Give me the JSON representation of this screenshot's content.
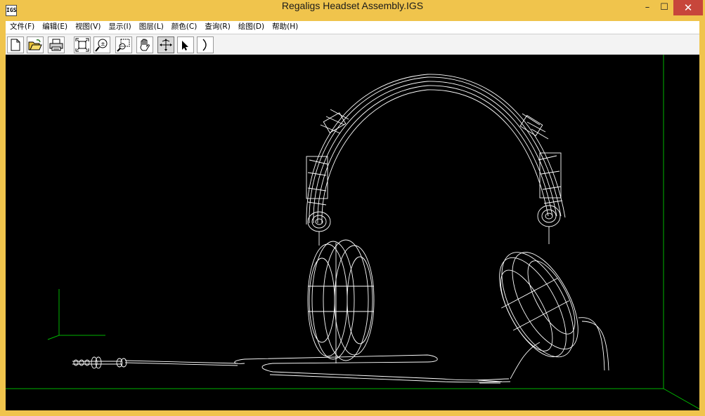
{
  "window": {
    "title": "Regaligs Headset Assembly.IGS",
    "app_icon_text": "IGS",
    "minimize_glyph": "–",
    "maximize_glyph": "☐",
    "close_glyph": "✕"
  },
  "menu": [
    {
      "label": "文件(F)"
    },
    {
      "label": "编辑(E)"
    },
    {
      "label": "视图(V)"
    },
    {
      "label": "显示(I)"
    },
    {
      "label": "图层(L)"
    },
    {
      "label": "颜色(C)"
    },
    {
      "label": "查询(R)"
    },
    {
      "label": "绘图(D)"
    },
    {
      "label": "帮助(H)"
    }
  ],
  "toolbar": {
    "buttons": [
      {
        "name": "new-file",
        "icon": "new-file-icon"
      },
      {
        "name": "open-file",
        "icon": "open-folder-icon"
      },
      {
        "name": "print",
        "icon": "printer-icon"
      },
      {
        "name": "zoom-fit",
        "icon": "zoom-fit-icon"
      },
      {
        "name": "zoom-dynamic",
        "icon": "zoom-dynamic-icon"
      },
      {
        "name": "zoom-window",
        "icon": "zoom-window-icon"
      },
      {
        "name": "pan",
        "icon": "hand-icon"
      },
      {
        "name": "rotate",
        "icon": "rotate-move-icon",
        "pressed": true
      },
      {
        "name": "select",
        "icon": "arrow-cursor-icon"
      },
      {
        "name": "arc",
        "icon": "arc-icon"
      }
    ]
  },
  "colors": {
    "titlebar": "#f0c44c",
    "viewport_bg": "#000000",
    "wireframe": "#ffffff",
    "axis": "#00b400",
    "close_button": "#c7463b"
  }
}
